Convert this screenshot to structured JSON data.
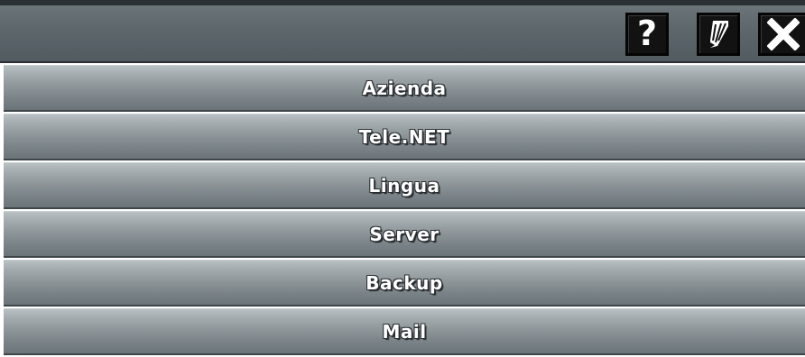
{
  "toolbar": {
    "buttons": [
      {
        "name": "help",
        "icon": "help-icon",
        "glyph": "?"
      },
      {
        "name": "edit",
        "icon": "pencil-icon"
      },
      {
        "name": "close",
        "icon": "close-icon"
      }
    ]
  },
  "menu": {
    "items": [
      {
        "label": "Azienda"
      },
      {
        "label": "Tele.NET"
      },
      {
        "label": "Lingua"
      },
      {
        "label": "Server"
      },
      {
        "label": "Backup"
      },
      {
        "label": "Mail"
      }
    ]
  },
  "colors": {
    "titlebar": "#5c666b",
    "menu_item_top": "#b9c0c3",
    "menu_item_bottom": "#6b7478",
    "button_bg": "#121212",
    "text": "#ffffff"
  }
}
